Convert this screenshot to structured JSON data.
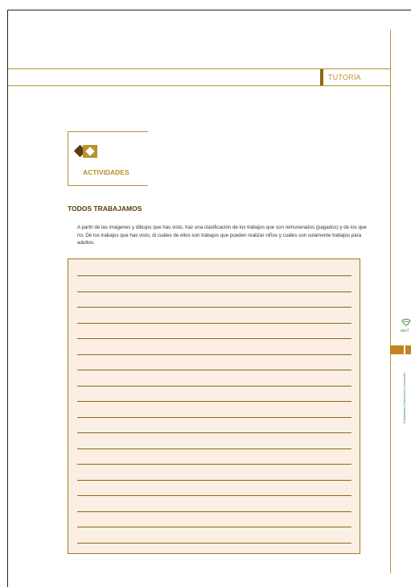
{
  "header": {
    "section_label": "TUTORÍA"
  },
  "activity": {
    "label": "ACTIVIDADES",
    "icon": "diamond-icon"
  },
  "exercise": {
    "title": "TODOS TRABAJAMOS",
    "instructions": "A partir de las imágenes y dibujos que has visto, haz una clasificación de los trabajos que son remunerados (pagados) y de los que no. De los trabajos que has visto, di cuáles de ellos son trabajos que pueden realizar niños y cuáles son solamente trabajos para adultos."
  },
  "sidebar": {
    "logo_text": "aecl",
    "vertical_text": "Solidaridad | Educación | Desarrollo"
  },
  "colors": {
    "accent": "#b8922f",
    "box_fill": "#fbeee2",
    "rule": "#8a6a14"
  },
  "answer_lines": 18
}
